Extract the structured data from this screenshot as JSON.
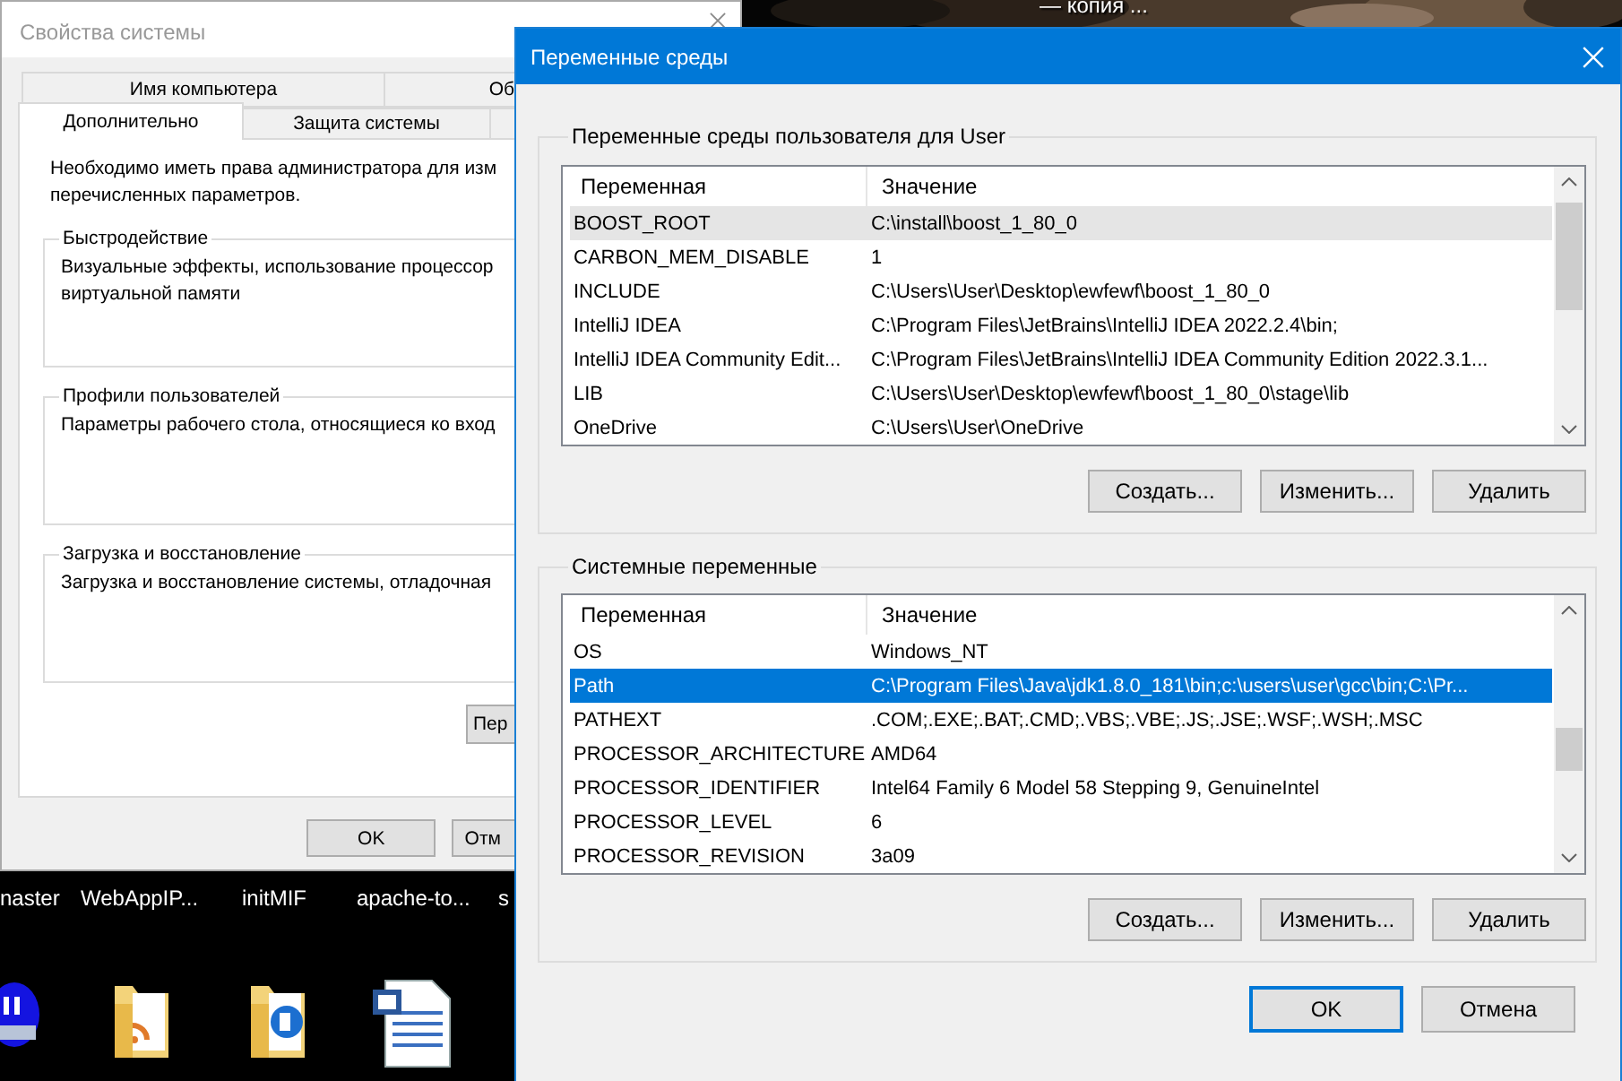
{
  "desktop": {
    "top_label": "— копия ...",
    "icons": [
      {
        "label": "naster"
      },
      {
        "label": "WebAppIP..."
      },
      {
        "label": "initMIF"
      },
      {
        "label": "apache-to..."
      },
      {
        "label": "s"
      }
    ],
    "bottom_icons": [
      {
        "kind": "badge"
      },
      {
        "kind": "folder-feed"
      },
      {
        "kind": "folder-page"
      },
      {
        "kind": "document"
      }
    ]
  },
  "system_properties": {
    "title": "Свойства системы",
    "tab_rows": [
      [
        {
          "label": "Имя компьютера",
          "selected": false
        },
        {
          "label": "Об",
          "selected": false
        }
      ],
      [
        {
          "label": "Дополнительно",
          "selected": true
        },
        {
          "label": "Защита системы",
          "selected": false
        }
      ]
    ],
    "description": "Необходимо иметь права администратора для изм\nперечисленных параметров.",
    "groups": [
      {
        "title": "Быстродействие",
        "text": "Визуальные эффекты, использование процессор\nвиртуальной памяти"
      },
      {
        "title": "Профили пользователей",
        "text": "Параметры рабочего стола, относящиеся ко вход"
      },
      {
        "title": "Загрузка и восстановление",
        "text": "Загрузка и восстановление системы, отладочная"
      }
    ],
    "panel_button": "Пер",
    "buttons": [
      "OK",
      "Отм"
    ]
  },
  "environment_variables": {
    "title": "Переменные среды",
    "user_variables": {
      "title": "Переменные среды пользователя для User",
      "focused": false,
      "columns": [
        "Переменная",
        "Значение"
      ],
      "rows": [
        {
          "name": "BOOST_ROOT",
          "value": "C:\\install\\boost_1_80_0",
          "selected": true
        },
        {
          "name": "CARBON_MEM_DISABLE",
          "value": "1",
          "selected": false
        },
        {
          "name": "INCLUDE",
          "value": "C:\\Users\\User\\Desktop\\ewfewf\\boost_1_80_0",
          "selected": false
        },
        {
          "name": "IntelliJ IDEA",
          "value": "C:\\Program Files\\JetBrains\\IntelliJ IDEA 2022.2.4\\bin;",
          "selected": false
        },
        {
          "name": "IntelliJ IDEA Community Edit...",
          "value": "C:\\Program Files\\JetBrains\\IntelliJ IDEA Community Edition 2022.3.1...",
          "selected": false
        },
        {
          "name": "LIB",
          "value": "C:\\Users\\User\\Desktop\\ewfewf\\boost_1_80_0\\stage\\lib",
          "selected": false
        },
        {
          "name": "OneDrive",
          "value": "C:\\Users\\User\\OneDrive",
          "selected": false
        }
      ],
      "buttons": [
        "Создать...",
        "Изменить...",
        "Удалить"
      ]
    },
    "system_variables": {
      "title": "Системные переменные",
      "focused": true,
      "columns": [
        "Переменная",
        "Значение"
      ],
      "rows": [
        {
          "name": "OS",
          "value": "Windows_NT",
          "selected": false
        },
        {
          "name": "Path",
          "value": "C:\\Program Files\\Java\\jdk1.8.0_181\\bin;c:\\users\\user\\gcc\\bin;C:\\Pr...",
          "selected": true
        },
        {
          "name": "PATHEXT",
          "value": ".COM;.EXE;.BAT;.CMD;.VBS;.VBE;.JS;.JSE;.WSF;.WSH;.MSC",
          "selected": false
        },
        {
          "name": "PROCESSOR_ARCHITECTURE",
          "value": "AMD64",
          "selected": false
        },
        {
          "name": "PROCESSOR_IDENTIFIER",
          "value": "Intel64 Family 6 Model 58 Stepping 9, GenuineIntel",
          "selected": false
        },
        {
          "name": "PROCESSOR_LEVEL",
          "value": "6",
          "selected": false
        },
        {
          "name": "PROCESSOR_REVISION",
          "value": "3a09",
          "selected": false
        }
      ],
      "buttons": [
        "Создать...",
        "Изменить...",
        "Удалить"
      ]
    },
    "buttons": [
      {
        "label": "OK",
        "default": true
      },
      {
        "label": "Отмена",
        "default": false
      }
    ]
  }
}
